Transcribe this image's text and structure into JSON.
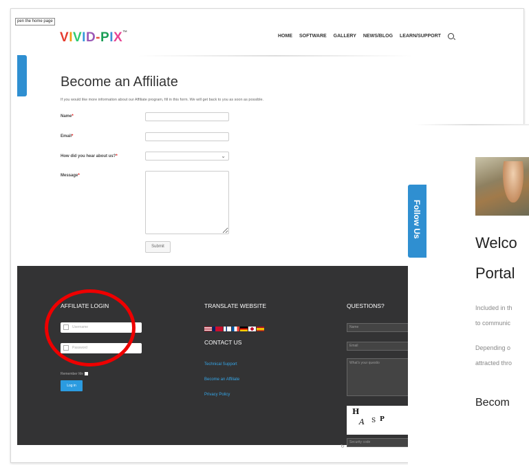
{
  "tooltip": "pen the home page",
  "logo": {
    "letters": [
      "V",
      "I",
      "V",
      "I",
      "D",
      "-",
      "P",
      "I",
      "X"
    ],
    "tm": "™"
  },
  "nav": {
    "items": [
      "HOME",
      "SOFTWARE",
      "GALLERY",
      "NEWS/BLOG",
      "LEARN/SUPPORT"
    ]
  },
  "form": {
    "title": "Become an Affiliate",
    "intro": "If you would like more information about our Affiliate program, fill in this form. We will get back to you as soon as possible.",
    "name_label": "Name",
    "email_label": "Email",
    "hear_label": "How did you hear about us?",
    "message_label": "Message",
    "required_mark": "*",
    "submit_label": "Submit"
  },
  "footer": {
    "affiliate_login": {
      "heading": "AFFILIATE LOGIN",
      "username_placeholder": "Username",
      "password_placeholder": "Password",
      "remember": "Remember Me",
      "login_label": "Log in"
    },
    "translate": {
      "heading": "TRANSLATE WEBSITE"
    },
    "contact": {
      "heading": "CONTACT US",
      "links": [
        "Technical Support",
        "Become an Affiliate",
        "Privacy Policy"
      ]
    },
    "questions": {
      "heading": "QUESTIONS?",
      "name_placeholder": "Name",
      "email_placeholder": "Email",
      "question_placeholder": "What's your questio",
      "captcha": [
        "H",
        "A",
        "S",
        "P"
      ],
      "security_placeholder": "Security code"
    }
  },
  "overlay": {
    "follow_us": "Follow Us",
    "welcome_line1": "Welco",
    "welcome_line2": "Portal",
    "para1_line1": "Included in th",
    "para1_line2": "to communic",
    "para2_line1": "Depending o",
    "para2_line2": "attracted thro",
    "become": "Becom"
  },
  "colors": {
    "accent": "#2f8fd1",
    "footer_bg": "#333334",
    "link": "#35a6e8",
    "highlight": "#e00000"
  }
}
